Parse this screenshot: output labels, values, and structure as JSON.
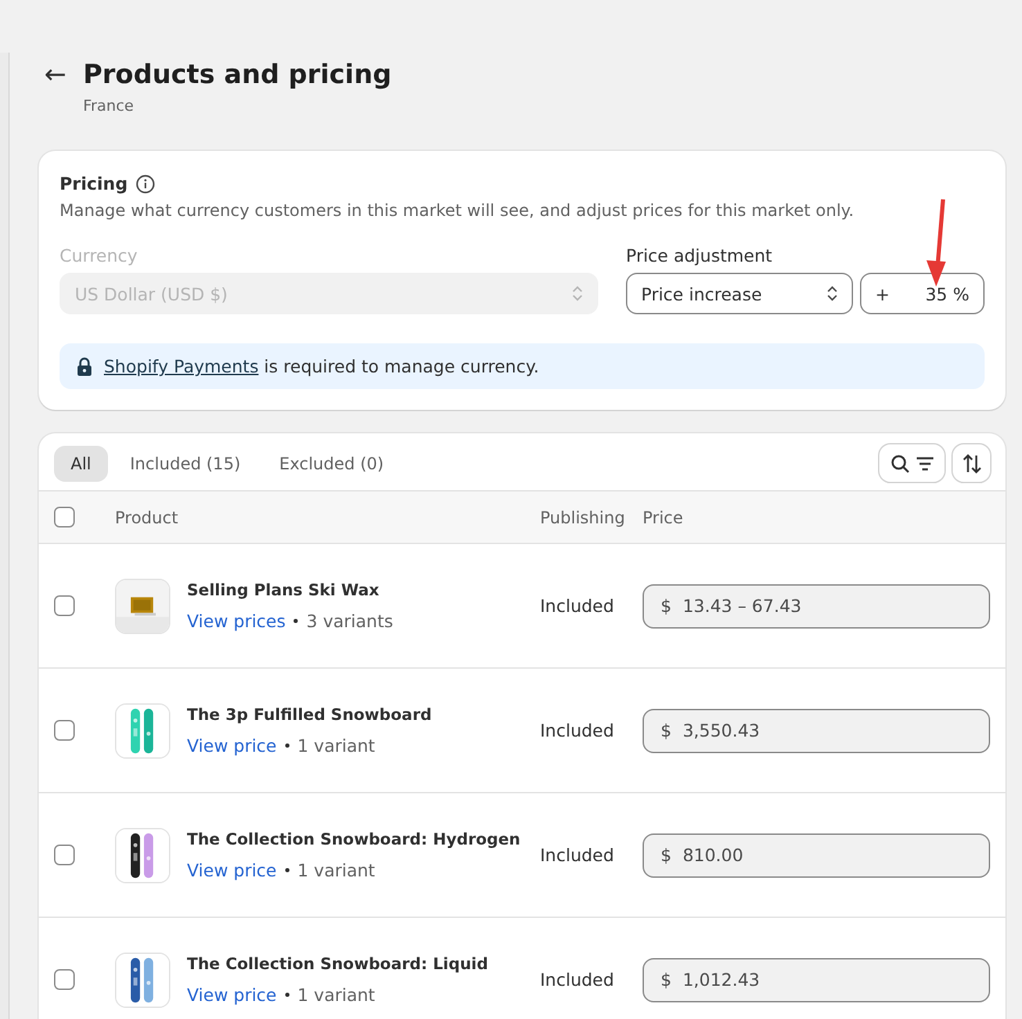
{
  "header": {
    "back": "←",
    "title": "Products and pricing",
    "subtitle": "France"
  },
  "pricing": {
    "title": "Pricing",
    "description": "Manage what currency customers in this market will see, and adjust prices for this market only.",
    "currency": {
      "label": "Currency",
      "value": "US Dollar (USD $)",
      "disabled": true
    },
    "adjustment": {
      "label": "Price adjustment",
      "value": "Price increase",
      "sign": "+",
      "amount": "35",
      "unit": "%"
    },
    "notice": {
      "link": "Shopify Payments",
      "text": " is required to manage currency."
    }
  },
  "products": {
    "tabs": [
      {
        "label": "All",
        "selected": true
      },
      {
        "label": "Included (15)",
        "selected": false
      },
      {
        "label": "Excluded (0)",
        "selected": false
      }
    ],
    "columns": [
      "Product",
      "Publishing",
      "Price"
    ],
    "select_all": {
      "checked": false
    },
    "rows": [
      {
        "name": "Selling Plans Ski Wax",
        "link": "View prices",
        "variants": "3 variants",
        "publishing": "Included",
        "currency": "$",
        "price": "13.43 – 67.43",
        "checked": false,
        "kind": "picture"
      },
      {
        "name": "The 3p Fulfilled Snowboard",
        "link": "View price",
        "variants": "1 variant",
        "publishing": "Included",
        "currency": "$",
        "price": "3,550.43",
        "checked": false,
        "kind": "picture"
      },
      {
        "name": "The Collection Snowboard: Hydrogen",
        "link": "View price",
        "variants": "1 variant",
        "publishing": "Included",
        "currency": "$",
        "price": "810.00",
        "checked": false,
        "kind": "picture"
      },
      {
        "name": "The Collection Snowboard: Liquid",
        "link": "View price",
        "variants": "1 variant",
        "publishing": "Included",
        "currency": "$",
        "price": "1,012.43",
        "checked": false,
        "kind": "picture"
      }
    ]
  }
}
